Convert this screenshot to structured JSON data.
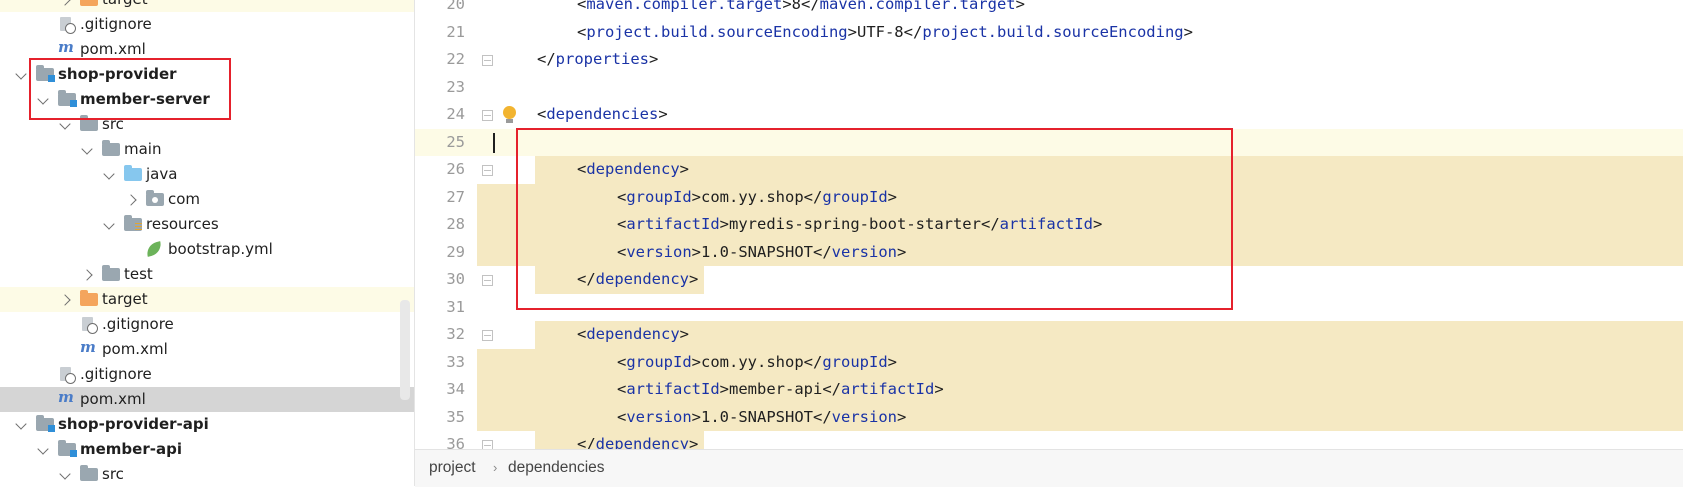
{
  "tree": {
    "items": [
      {
        "label": "target",
        "kind": "folder-orange",
        "expand": "right",
        "bold": false
      },
      {
        "label": ".gitignore",
        "kind": "gitignore",
        "expand": "none",
        "bold": false
      },
      {
        "label": "pom.xml",
        "kind": "pom",
        "expand": "none",
        "bold": false
      },
      {
        "label": "shop-provider",
        "kind": "module",
        "expand": "down",
        "bold": true
      },
      {
        "label": "member-server",
        "kind": "module",
        "expand": "down",
        "bold": true
      },
      {
        "label": "src",
        "kind": "folder-gray",
        "expand": "down",
        "bold": false
      },
      {
        "label": "main",
        "kind": "folder-gray",
        "expand": "down",
        "bold": false
      },
      {
        "label": "java",
        "kind": "folder-blue",
        "expand": "down",
        "bold": false
      },
      {
        "label": "com",
        "kind": "package",
        "expand": "right",
        "bold": false
      },
      {
        "label": "resources",
        "kind": "folder-res",
        "expand": "down",
        "bold": false
      },
      {
        "label": "bootstrap.yml",
        "kind": "yml",
        "expand": "none",
        "bold": false
      },
      {
        "label": "test",
        "kind": "folder-gray",
        "expand": "right",
        "bold": false
      },
      {
        "label": "target",
        "kind": "folder-orange",
        "expand": "right",
        "bold": false
      },
      {
        "label": ".gitignore",
        "kind": "gitignore",
        "expand": "none",
        "bold": false
      },
      {
        "label": "pom.xml",
        "kind": "pom",
        "expand": "none",
        "bold": false
      },
      {
        "label": ".gitignore",
        "kind": "gitignore",
        "expand": "none",
        "bold": false
      },
      {
        "label": "pom.xml",
        "kind": "pom",
        "expand": "none",
        "bold": false,
        "selected": true
      },
      {
        "label": "shop-provider-api",
        "kind": "module",
        "expand": "down",
        "bold": true
      },
      {
        "label": "member-api",
        "kind": "module",
        "expand": "down",
        "bold": true
      },
      {
        "label": "src",
        "kind": "folder-gray",
        "expand": "down",
        "bold": false
      }
    ]
  },
  "editor": {
    "lines": [
      {
        "num": "20",
        "indent": 2,
        "parts": [
          [
            "b",
            "<"
          ],
          [
            "t",
            "maven.compiler.target"
          ],
          [
            "b",
            ">"
          ],
          [
            "x",
            "8"
          ],
          [
            "b",
            "</"
          ],
          [
            "t",
            "maven.compiler.target"
          ],
          [
            "b",
            ">"
          ]
        ]
      },
      {
        "num": "21",
        "indent": 2,
        "parts": [
          [
            "b",
            "<"
          ],
          [
            "t",
            "project.build.sourceEncoding"
          ],
          [
            "b",
            ">"
          ],
          [
            "x",
            "UTF-8"
          ],
          [
            "b",
            "</"
          ],
          [
            "t",
            "project.build.sourceEncoding"
          ],
          [
            "b",
            ">"
          ]
        ]
      },
      {
        "num": "22",
        "indent": 1,
        "parts": [
          [
            "b",
            "</"
          ],
          [
            "t",
            "properties"
          ],
          [
            "b",
            ">"
          ]
        ]
      },
      {
        "num": "23",
        "indent": 0,
        "parts": []
      },
      {
        "num": "24",
        "indent": 1,
        "parts": [
          [
            "b",
            "<"
          ],
          [
            "t",
            "dependencies"
          ],
          [
            "b",
            ">"
          ]
        ]
      },
      {
        "num": "25",
        "indent": 0,
        "parts": []
      },
      {
        "num": "26",
        "indent": 2,
        "parts": [
          [
            "b",
            "<"
          ],
          [
            "t",
            "dependency"
          ],
          [
            "b",
            ">"
          ]
        ]
      },
      {
        "num": "27",
        "indent": 3,
        "parts": [
          [
            "b",
            "<"
          ],
          [
            "t",
            "groupId"
          ],
          [
            "b",
            ">"
          ],
          [
            "x",
            "com.yy.shop"
          ],
          [
            "b",
            "</"
          ],
          [
            "t",
            "groupId"
          ],
          [
            "b",
            ">"
          ]
        ]
      },
      {
        "num": "28",
        "indent": 3,
        "parts": [
          [
            "b",
            "<"
          ],
          [
            "t",
            "artifactId"
          ],
          [
            "b",
            ">"
          ],
          [
            "x",
            "myredis-spring-boot-starter"
          ],
          [
            "b",
            "</"
          ],
          [
            "t",
            "artifactId"
          ],
          [
            "b",
            ">"
          ]
        ]
      },
      {
        "num": "29",
        "indent": 3,
        "parts": [
          [
            "b",
            "<"
          ],
          [
            "t",
            "version"
          ],
          [
            "b",
            ">"
          ],
          [
            "x",
            "1.0-SNAPSHOT"
          ],
          [
            "b",
            "</"
          ],
          [
            "t",
            "version"
          ],
          [
            "b",
            ">"
          ]
        ]
      },
      {
        "num": "30",
        "indent": 2,
        "parts": [
          [
            "b",
            "</"
          ],
          [
            "t",
            "dependency"
          ],
          [
            "b",
            ">"
          ]
        ]
      },
      {
        "num": "31",
        "indent": 0,
        "parts": []
      },
      {
        "num": "32",
        "indent": 2,
        "parts": [
          [
            "b",
            "<"
          ],
          [
            "t",
            "dependency"
          ],
          [
            "b",
            ">"
          ]
        ]
      },
      {
        "num": "33",
        "indent": 3,
        "parts": [
          [
            "b",
            "<"
          ],
          [
            "t",
            "groupId"
          ],
          [
            "b",
            ">"
          ],
          [
            "x",
            "com.yy.shop"
          ],
          [
            "b",
            "</"
          ],
          [
            "t",
            "groupId"
          ],
          [
            "b",
            ">"
          ]
        ]
      },
      {
        "num": "34",
        "indent": 3,
        "parts": [
          [
            "b",
            "<"
          ],
          [
            "t",
            "artifactId"
          ],
          [
            "b",
            ">"
          ],
          [
            "x",
            "member-api"
          ],
          [
            "b",
            "</"
          ],
          [
            "t",
            "artifactId"
          ],
          [
            "b",
            ">"
          ]
        ]
      },
      {
        "num": "35",
        "indent": 3,
        "parts": [
          [
            "b",
            "<"
          ],
          [
            "t",
            "version"
          ],
          [
            "b",
            ">"
          ],
          [
            "x",
            "1.0-SNAPSHOT"
          ],
          [
            "b",
            "</"
          ],
          [
            "t",
            "version"
          ],
          [
            "b",
            ">"
          ]
        ]
      },
      {
        "num": "36",
        "indent": 2,
        "parts": [
          [
            "b",
            "</"
          ],
          [
            "t",
            "dependency"
          ],
          [
            "b",
            ">"
          ]
        ]
      }
    ]
  },
  "breadcrumb": {
    "items": [
      "project",
      "dependencies"
    ],
    "separator": "›"
  },
  "colors": {
    "tag": "#1a33a6",
    "highlight": "#f5e9c3",
    "current_line": "#fdfbe6",
    "annotation": "#e5212c"
  }
}
